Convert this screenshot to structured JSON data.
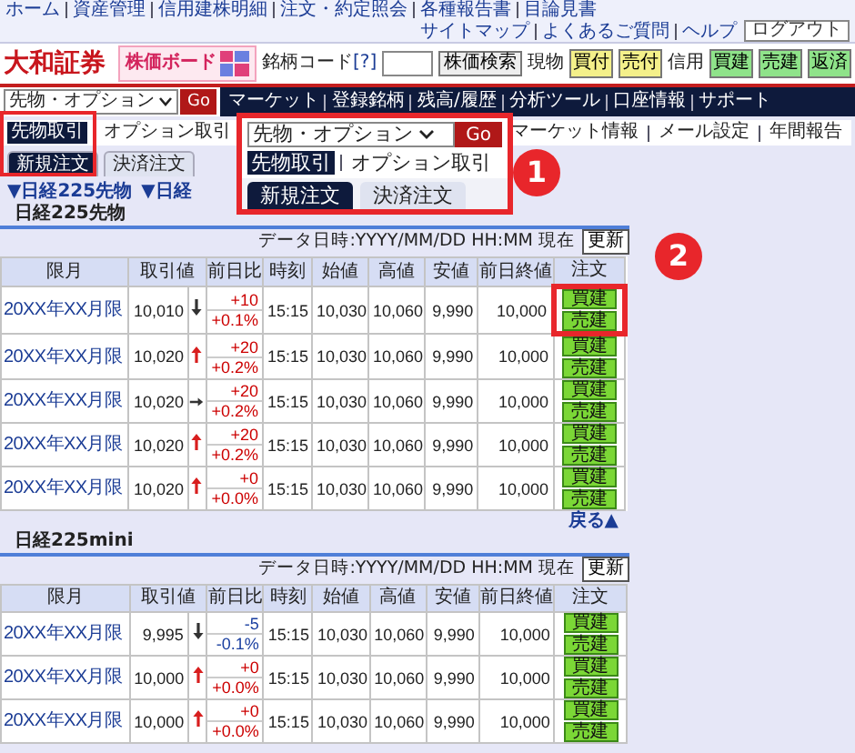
{
  "top_nav": {
    "links": [
      "ホーム",
      "資産管理",
      "信用建株明細",
      "注文・約定照会",
      "各種報告書",
      "目論見書"
    ],
    "util_links": [
      "サイトマップ",
      "よくあるご質問",
      "ヘルプ"
    ],
    "logout": "ログアウト"
  },
  "header": {
    "logo": "大和証券",
    "banner": "株価ボード",
    "code_label": "銘柄コード",
    "help": "[?]",
    "search_button": "株価検索",
    "groups": [
      {
        "label": "現物",
        "kind": "cash",
        "buttons": [
          "買付",
          "売付"
        ]
      },
      {
        "label": "信用",
        "kind": "margin",
        "buttons": [
          "買建",
          "売建",
          "返済"
        ]
      }
    ]
  },
  "product_select": {
    "value": "先物・オプション",
    "go": "Go"
  },
  "main_nav": [
    "マーケット",
    "登録銘柄",
    "残高/履歴",
    "分析ツール",
    "口座情報",
    "サポート"
  ],
  "sub_nav": [
    {
      "label": "先物取引",
      "selected": true
    },
    {
      "label": "オプション取引",
      "selected": false
    },
    {
      "label": "マーケット情報",
      "selected": false
    },
    {
      "label": "メール設定",
      "selected": false
    },
    {
      "label": "年間報告",
      "selected": false
    }
  ],
  "order_tabs": [
    {
      "label": "新規注文",
      "selected": true
    },
    {
      "label": "決済注文",
      "selected": false
    }
  ],
  "anchors": [
    "▼日経225先物",
    "▼日経"
  ],
  "sections": [
    {
      "title": "日経225先物",
      "data_time": "データ日時:YYYY/MM/DD HH:MM 現在",
      "refresh": "更新",
      "back": "戻る▲",
      "columns": [
        "限月",
        "取引値",
        "前日比",
        "時刻",
        "始値",
        "高値",
        "安値",
        "前日終値",
        "注文"
      ],
      "rows": [
        {
          "month": "20XX年XX月限",
          "price": "10,010",
          "kind": "down",
          "change": "+10",
          "change_pct": "+0.1%",
          "color": "#cc0000",
          "time": "15:15",
          "open": "10,030",
          "high": "10,060",
          "low": "9,990",
          "prev_close": "10,000",
          "buy": "買建",
          "sell": "売建",
          "highlighted": true
        },
        {
          "month": "20XX年XX月限",
          "price": "10,020",
          "kind": "up",
          "change": "+20",
          "change_pct": "+0.2%",
          "color": "#cc0000",
          "time": "15:15",
          "open": "10,030",
          "high": "10,060",
          "low": "9,990",
          "prev_close": "10,000",
          "buy": "買建",
          "sell": "売建",
          "highlighted": false
        },
        {
          "month": "20XX年XX月限",
          "price": "10,020",
          "kind": "flat",
          "change": "+20",
          "change_pct": "+0.2%",
          "color": "#cc0000",
          "time": "15:15",
          "open": "10,030",
          "high": "10,060",
          "low": "9,990",
          "prev_close": "10,000",
          "buy": "買建",
          "sell": "売建",
          "highlighted": false
        },
        {
          "month": "20XX年XX月限",
          "price": "10,020",
          "kind": "up",
          "change": "+20",
          "change_pct": "+0.2%",
          "color": "#cc0000",
          "time": "15:15",
          "open": "10,030",
          "high": "10,060",
          "low": "9,990",
          "prev_close": "10,000",
          "buy": "買建",
          "sell": "売建",
          "highlighted": false
        },
        {
          "month": "20XX年XX月限",
          "price": "10,020",
          "kind": "up",
          "change": "+0",
          "change_pct": "+0.0%",
          "color": "#cc0000",
          "time": "15:15",
          "open": "10,030",
          "high": "10,060",
          "low": "9,990",
          "prev_close": "10,000",
          "buy": "買建",
          "sell": "売建",
          "highlighted": false
        }
      ]
    },
    {
      "title": "日経225mini",
      "data_time": "データ日時:YYYY/MM/DD HH:MM 現在",
      "refresh": "更新",
      "columns": [
        "限月",
        "取引値",
        "前日比",
        "時刻",
        "始値",
        "高値",
        "安値",
        "前日終値",
        "注文"
      ],
      "rows": [
        {
          "month": "20XX年XX月限",
          "price": "9,995",
          "kind": "down",
          "change": "-5",
          "change_pct": "-0.1%",
          "color": "#1a3fa0",
          "time": "15:15",
          "open": "10,030",
          "high": "10,060",
          "low": "9,990",
          "prev_close": "10,000",
          "buy": "買建",
          "sell": "売建",
          "highlighted": false
        },
        {
          "month": "20XX年XX月限",
          "price": "10,000",
          "kind": "up",
          "change": "+0",
          "change_pct": "+0.0%",
          "color": "#cc0000",
          "time": "15:15",
          "open": "10,030",
          "high": "10,060",
          "low": "9,990",
          "prev_close": "10,000",
          "buy": "買建",
          "sell": "売建",
          "highlighted": false
        },
        {
          "month": "20XX年XX月限",
          "price": "10,000",
          "kind": "up",
          "change": "+0",
          "change_pct": "+0.0%",
          "color": "#cc0000",
          "time": "15:15",
          "open": "10,030",
          "high": "10,060",
          "low": "9,990",
          "prev_close": "10,000",
          "buy": "買建",
          "sell": "売建",
          "highlighted": false
        }
      ]
    }
  ],
  "callouts": [
    {
      "number": "1",
      "panel": {
        "select": "先物・オプション",
        "go": "Go",
        "sub_nav": [
          {
            "label": "先物取引",
            "selected": true
          },
          {
            "label": "オプション取引",
            "selected": false
          }
        ],
        "tabs": [
          {
            "label": "新規注文",
            "selected": true
          },
          {
            "label": "決済注文",
            "selected": false
          }
        ]
      }
    },
    {
      "number": "2"
    }
  ]
}
